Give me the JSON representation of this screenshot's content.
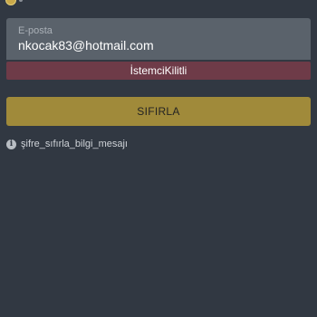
{
  "form": {
    "email_label": "E-posta",
    "email_value": "nkocak83@hotmail.com",
    "error_text": "İstemciKilitli",
    "reset_label": "SIFIRLA",
    "info_text": "şifre_sıfırla_bilgi_mesajı"
  },
  "icons": {
    "info": "info-icon",
    "top": "coin-icon"
  },
  "colors": {
    "background": "#313842",
    "input_background": "#5a626b",
    "error_background": "#6e3b48",
    "button_background": "#a08a3a"
  }
}
